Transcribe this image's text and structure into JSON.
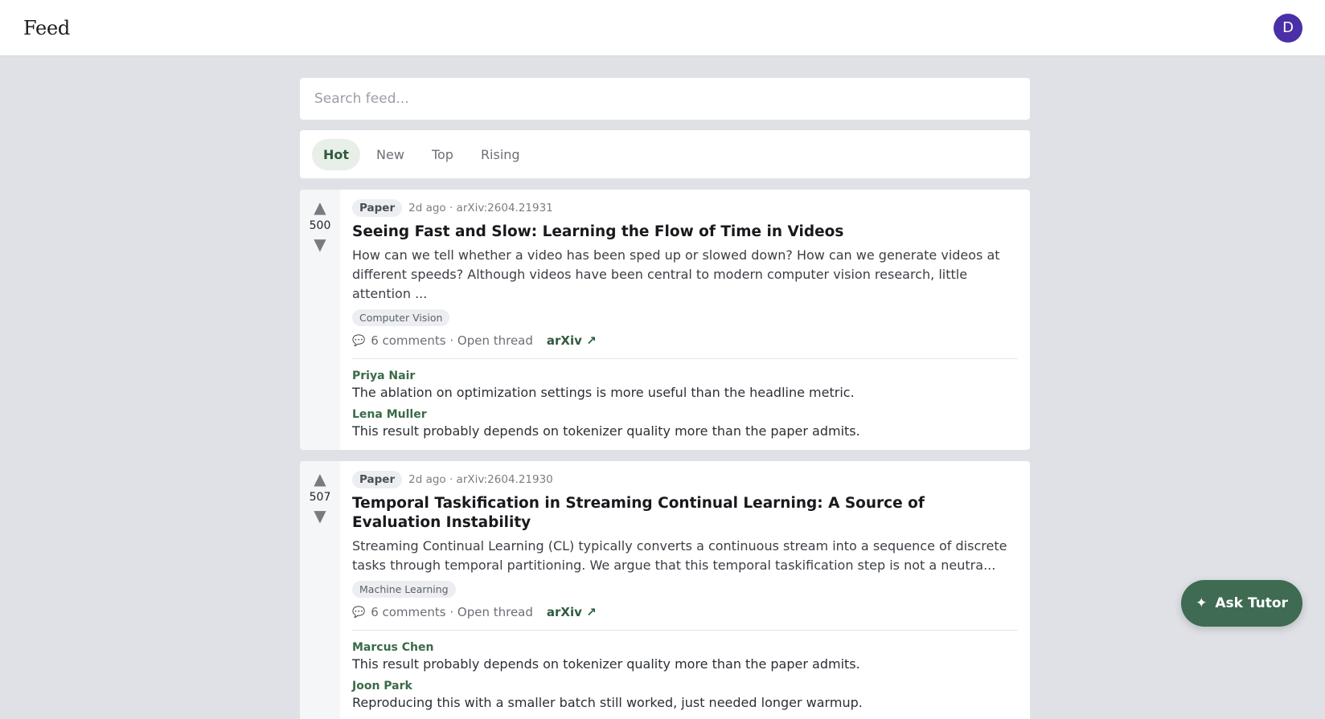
{
  "header": {
    "title": "Feed",
    "avatar_initial": "D"
  },
  "search": {
    "placeholder": "Search feed..."
  },
  "tabs": [
    {
      "label": "Hot",
      "active": true
    },
    {
      "label": "New",
      "active": false
    },
    {
      "label": "Top",
      "active": false
    },
    {
      "label": "Rising",
      "active": false
    }
  ],
  "posts": [
    {
      "score": "500",
      "type": "Paper",
      "meta": "2d ago · arXiv:2604.21931",
      "title": "Seeing Fast and Slow: Learning the Flow of Time in Videos",
      "abstract": "How can we tell whether a video has been sped up or slowed down? How can we generate videos at different speeds? Although videos have been central to modern computer vision research, little attention ...",
      "tag": "Computer Vision",
      "comments_label": "6 comments · Open thread",
      "link_label": "arXiv ↗",
      "comments": [
        {
          "author": "Priya Nair",
          "text": "The ablation on optimization settings is more useful than the headline metric."
        },
        {
          "author": "Lena Muller",
          "text": "This result probably depends on tokenizer quality more than the paper admits."
        }
      ]
    },
    {
      "score": "507",
      "type": "Paper",
      "meta": "2d ago · arXiv:2604.21930",
      "title": "Temporal Taskification in Streaming Continual Learning: A Source of Evaluation Instability",
      "abstract": "Streaming Continual Learning (CL) typically converts a continuous stream into a sequence of discrete tasks through temporal partitioning. We argue that this temporal taskification step is not a neutra...",
      "tag": "Machine Learning",
      "comments_label": "6 comments · Open thread",
      "link_label": "arXiv ↗",
      "comments": [
        {
          "author": "Marcus Chen",
          "text": "This result probably depends on tokenizer quality more than the paper admits."
        },
        {
          "author": "Joon Park",
          "text": "Reproducing this with a smaller batch still worked, just needed longer warmup."
        }
      ]
    }
  ],
  "fab": {
    "label": "Ask Tutor"
  },
  "icons": {
    "upvote": "▲",
    "downvote": "▼",
    "comment": "💬",
    "sparkle": "✦"
  },
  "colors": {
    "accent_green": "#3e6b52",
    "avatar_purple": "#4b2fa6",
    "background": "#dfe1e6"
  }
}
